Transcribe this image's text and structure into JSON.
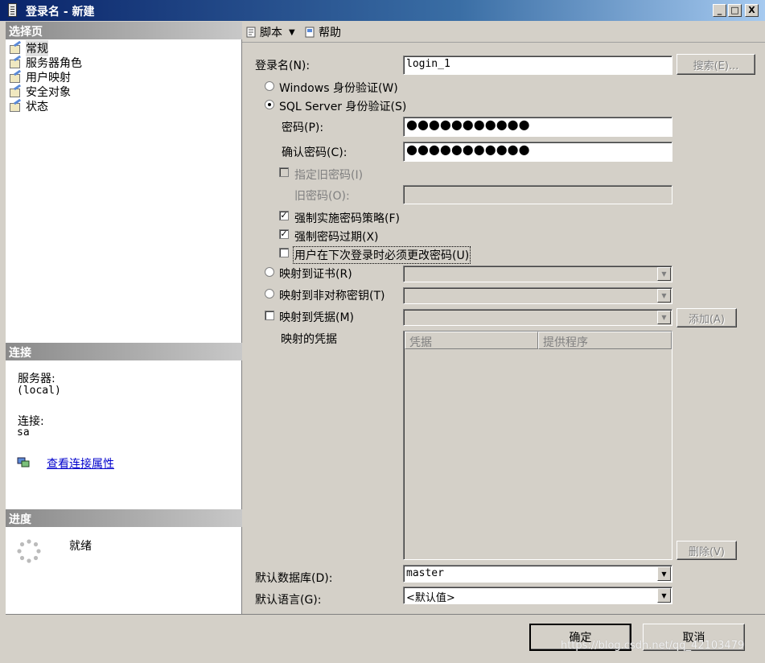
{
  "window": {
    "title": "登录名 - 新建",
    "controls": [
      "_",
      "□",
      "X"
    ]
  },
  "sidebar": {
    "select_page_header": "选择页",
    "items": [
      {
        "label": "常规"
      },
      {
        "label": "服务器角色"
      },
      {
        "label": "用户映射"
      },
      {
        "label": "安全对象"
      },
      {
        "label": "状态"
      }
    ],
    "connection_header": "连接",
    "server_label": "服务器:",
    "server_value": "(local)",
    "connection_label": "连接:",
    "connection_value": "sa",
    "view_connection_link": "查看连接属性",
    "progress_header": "进度",
    "progress_status": "就绪"
  },
  "toolbar": {
    "script_label": "脚本",
    "help_label": "帮助"
  },
  "form": {
    "login_name_label": "登录名(N):",
    "login_name_value": "login_1",
    "search_button": "搜索(E)...",
    "windows_auth_label": "Windows 身份验证(W)",
    "sql_auth_label": "SQL Server 身份验证(S)",
    "password_label": "密码(P):",
    "password_value": "●●●●●●●●●●●",
    "confirm_password_label": "确认密码(C):",
    "confirm_password_value": "●●●●●●●●●●●",
    "specify_old_password_label": "指定旧密码(I)",
    "old_password_label": "旧密码(O):",
    "enforce_policy_label": "强制实施密码策略(F)",
    "enforce_expiration_label": "强制密码过期(X)",
    "must_change_label": "用户在下次登录时必须更改密码(U)",
    "map_cert_label": "映射到证书(R)",
    "map_asym_key_label": "映射到非对称密钥(T)",
    "map_credential_label": "映射到凭据(M)",
    "add_button": "添加(A)",
    "mapped_credentials_label": "映射的凭据",
    "cred_col_credential": "凭据",
    "cred_col_provider": "提供程序",
    "remove_button": "删除(V)",
    "default_db_label": "默认数据库(D):",
    "default_db_value": "master",
    "default_lang_label": "默认语言(G):",
    "default_lang_value": "<默认值>"
  },
  "footer": {
    "ok_button": "确定",
    "cancel_button": "取消",
    "watermark": "https://blog.csdn.net/qq_42103479"
  }
}
